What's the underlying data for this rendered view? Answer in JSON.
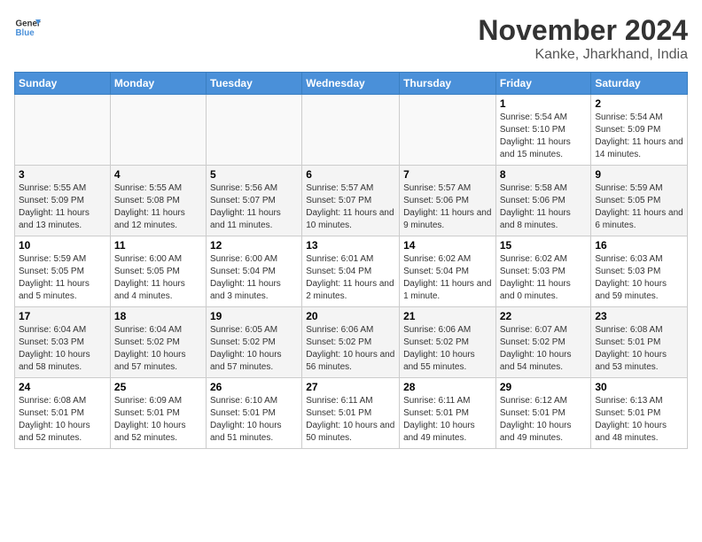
{
  "header": {
    "logo_line1": "General",
    "logo_line2": "Blue",
    "month": "November 2024",
    "location": "Kanke, Jharkhand, India"
  },
  "weekdays": [
    "Sunday",
    "Monday",
    "Tuesday",
    "Wednesday",
    "Thursday",
    "Friday",
    "Saturday"
  ],
  "weeks": [
    [
      {
        "day": "",
        "info": ""
      },
      {
        "day": "",
        "info": ""
      },
      {
        "day": "",
        "info": ""
      },
      {
        "day": "",
        "info": ""
      },
      {
        "day": "",
        "info": ""
      },
      {
        "day": "1",
        "info": "Sunrise: 5:54 AM\nSunset: 5:10 PM\nDaylight: 11 hours and 15 minutes."
      },
      {
        "day": "2",
        "info": "Sunrise: 5:54 AM\nSunset: 5:09 PM\nDaylight: 11 hours and 14 minutes."
      }
    ],
    [
      {
        "day": "3",
        "info": "Sunrise: 5:55 AM\nSunset: 5:09 PM\nDaylight: 11 hours and 13 minutes."
      },
      {
        "day": "4",
        "info": "Sunrise: 5:55 AM\nSunset: 5:08 PM\nDaylight: 11 hours and 12 minutes."
      },
      {
        "day": "5",
        "info": "Sunrise: 5:56 AM\nSunset: 5:07 PM\nDaylight: 11 hours and 11 minutes."
      },
      {
        "day": "6",
        "info": "Sunrise: 5:57 AM\nSunset: 5:07 PM\nDaylight: 11 hours and 10 minutes."
      },
      {
        "day": "7",
        "info": "Sunrise: 5:57 AM\nSunset: 5:06 PM\nDaylight: 11 hours and 9 minutes."
      },
      {
        "day": "8",
        "info": "Sunrise: 5:58 AM\nSunset: 5:06 PM\nDaylight: 11 hours and 8 minutes."
      },
      {
        "day": "9",
        "info": "Sunrise: 5:59 AM\nSunset: 5:05 PM\nDaylight: 11 hours and 6 minutes."
      }
    ],
    [
      {
        "day": "10",
        "info": "Sunrise: 5:59 AM\nSunset: 5:05 PM\nDaylight: 11 hours and 5 minutes."
      },
      {
        "day": "11",
        "info": "Sunrise: 6:00 AM\nSunset: 5:05 PM\nDaylight: 11 hours and 4 minutes."
      },
      {
        "day": "12",
        "info": "Sunrise: 6:00 AM\nSunset: 5:04 PM\nDaylight: 11 hours and 3 minutes."
      },
      {
        "day": "13",
        "info": "Sunrise: 6:01 AM\nSunset: 5:04 PM\nDaylight: 11 hours and 2 minutes."
      },
      {
        "day": "14",
        "info": "Sunrise: 6:02 AM\nSunset: 5:04 PM\nDaylight: 11 hours and 1 minute."
      },
      {
        "day": "15",
        "info": "Sunrise: 6:02 AM\nSunset: 5:03 PM\nDaylight: 11 hours and 0 minutes."
      },
      {
        "day": "16",
        "info": "Sunrise: 6:03 AM\nSunset: 5:03 PM\nDaylight: 10 hours and 59 minutes."
      }
    ],
    [
      {
        "day": "17",
        "info": "Sunrise: 6:04 AM\nSunset: 5:03 PM\nDaylight: 10 hours and 58 minutes."
      },
      {
        "day": "18",
        "info": "Sunrise: 6:04 AM\nSunset: 5:02 PM\nDaylight: 10 hours and 57 minutes."
      },
      {
        "day": "19",
        "info": "Sunrise: 6:05 AM\nSunset: 5:02 PM\nDaylight: 10 hours and 57 minutes."
      },
      {
        "day": "20",
        "info": "Sunrise: 6:06 AM\nSunset: 5:02 PM\nDaylight: 10 hours and 56 minutes."
      },
      {
        "day": "21",
        "info": "Sunrise: 6:06 AM\nSunset: 5:02 PM\nDaylight: 10 hours and 55 minutes."
      },
      {
        "day": "22",
        "info": "Sunrise: 6:07 AM\nSunset: 5:02 PM\nDaylight: 10 hours and 54 minutes."
      },
      {
        "day": "23",
        "info": "Sunrise: 6:08 AM\nSunset: 5:01 PM\nDaylight: 10 hours and 53 minutes."
      }
    ],
    [
      {
        "day": "24",
        "info": "Sunrise: 6:08 AM\nSunset: 5:01 PM\nDaylight: 10 hours and 52 minutes."
      },
      {
        "day": "25",
        "info": "Sunrise: 6:09 AM\nSunset: 5:01 PM\nDaylight: 10 hours and 52 minutes."
      },
      {
        "day": "26",
        "info": "Sunrise: 6:10 AM\nSunset: 5:01 PM\nDaylight: 10 hours and 51 minutes."
      },
      {
        "day": "27",
        "info": "Sunrise: 6:11 AM\nSunset: 5:01 PM\nDaylight: 10 hours and 50 minutes."
      },
      {
        "day": "28",
        "info": "Sunrise: 6:11 AM\nSunset: 5:01 PM\nDaylight: 10 hours and 49 minutes."
      },
      {
        "day": "29",
        "info": "Sunrise: 6:12 AM\nSunset: 5:01 PM\nDaylight: 10 hours and 49 minutes."
      },
      {
        "day": "30",
        "info": "Sunrise: 6:13 AM\nSunset: 5:01 PM\nDaylight: 10 hours and 48 minutes."
      }
    ]
  ]
}
